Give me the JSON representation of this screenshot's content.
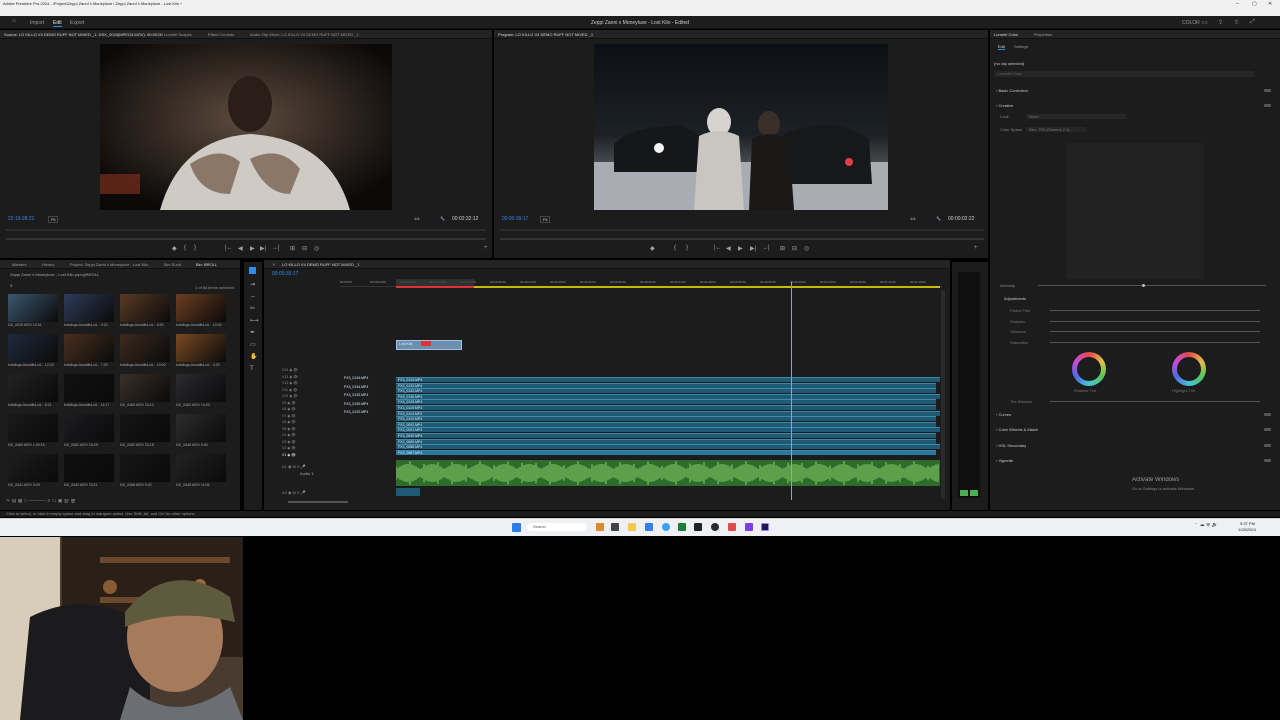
{
  "window": {
    "title": "Adobe Premiere Pro 2024 - \\Project\\Zeppi Zanni x Moneyluxe \\ Zeppi Zanni x Moneyluxe - Lost Kilo *",
    "controls": [
      "–",
      "▢",
      "✕"
    ]
  },
  "menu": [
    "File",
    "Edit",
    "Clip",
    "Sequence",
    "Markers",
    "Graphics and Titles",
    "View",
    "Window",
    "Help"
  ],
  "workspace": {
    "tabs": [
      "Import",
      "Edit",
      "Export"
    ],
    "active_tab": "Edit",
    "project_title": "Zeppi Zanni x Moneyluxe - Lost Kilo - Edited",
    "right_label": "COLOR"
  },
  "source_monitor": {
    "tabs": [
      "Source: LO KILLO V4 DEMO  RUFF NOT MIXED _1: DSX_0033(MPEG4.MOV): 00:00:00",
      "Lumetri Scopes",
      "Effect Controls",
      "Audio Clip Mixer: LO KILLO V4 DEMO  RUFF NOT MIXED _1"
    ],
    "timecode_left": "22:19:28:21",
    "fit": "Fit",
    "resolution": "1/4",
    "timecode_right": "00:02:32:12"
  },
  "program_monitor": {
    "tabs": [
      "Program: LO KILLO V4 DEMO  RUFF NOT MIXED _1"
    ],
    "timecode_left": "00:00:39:17",
    "fit": "Fit",
    "resolution": "1/4",
    "timecode_right": "00:00:02:22"
  },
  "transport_icons": [
    "◆",
    "{",
    "}",
    "|←",
    "◀",
    "▶",
    "▶|",
    "→|",
    "⊞",
    "⊟",
    "◎",
    "+"
  ],
  "project_panel": {
    "tabs": [
      "Markers",
      "History",
      "Project: Zeppi Zanni x Moneyluxe - Lost Kilo",
      "Bin: B-roll",
      "Bin: BROLL"
    ],
    "path": "Zeppi Zanni x Moneyluxe - Lost Kilo.prproj\\BROLL",
    "count": "1 of 84 items selected",
    "items": [
      {
        "name": "DJI_0026.MOV",
        "dur": "12:01"
      },
      {
        "name": "buildings-beautiful-cit...",
        "dur": "9:22"
      },
      {
        "name": "buildings-beautiful-cit...",
        "dur": "8:00"
      },
      {
        "name": "buildings-beautiful-cit...",
        "dur": "10:24"
      },
      {
        "name": "buildings-beautiful-cit...",
        "dur": "12:23"
      },
      {
        "name": "buildings-beautiful-cit...",
        "dur": "7:29"
      },
      {
        "name": "buildings-beautiful-cit...",
        "dur": "10:00"
      },
      {
        "name": "buildings-beautiful-cit...",
        "dur": "9:29"
      },
      {
        "name": "buildings-beautiful-cit...",
        "dur": "8:21"
      },
      {
        "name": "buildings-beautiful-cit...",
        "dur": "11:17"
      },
      {
        "name": "DJI_0463.MOV",
        "dur": "24:10"
      },
      {
        "name": "DJI_0462.MOV",
        "dur": "14:20"
      },
      {
        "name": "DJI_0460.MOV",
        "dur": "1:00:15"
      },
      {
        "name": "DJI_0451.MOV",
        "dur": "15:29"
      },
      {
        "name": "DJI_0452.MOV",
        "dur": "23:18"
      },
      {
        "name": "DJI_0446.MOV",
        "dur": "5:00"
      },
      {
        "name": "DJI_0441.MOV",
        "dur": "3:29"
      },
      {
        "name": "DJI_0442.MOV",
        "dur": "20:11"
      },
      {
        "name": "DJI_0456.MOV",
        "dur": "9:22"
      },
      {
        "name": "DJI_0448.MOV",
        "dur": "11:05"
      }
    ]
  },
  "timeline": {
    "tab": "LO KILLO V4 DEMO  RUFF NOT MIXED _1",
    "timecode": "00:00:39:17",
    "ruler": [
      "00:00:00",
      "00:00:04:00",
      "00:00:08:00",
      "00:00:12:00",
      "00:00:16:00",
      "00:00:20:00",
      "00:00:24:00",
      "00:00:28:00",
      "00:00:32:00",
      "00:00:36:00",
      "00:00:40:00",
      "00:00:44:00",
      "00:00:48:00",
      "00:00:52:00",
      "00:00:56:00",
      "00:01:00:00",
      "00:01:04:00",
      "00:01:08:00",
      "00:01:12:00",
      "00:01:16:00"
    ],
    "video_tracks": [
      "V14",
      "V13",
      "V12",
      "V11",
      "V10",
      "V9",
      "V8",
      "V7",
      "V6",
      "V5",
      "V4",
      "V3",
      "V2",
      "V1"
    ],
    "audio_tracks": [
      "A1",
      "A2"
    ],
    "audio_label": "Audio 1",
    "clips": [
      "FX3_0134.MP4",
      "FX3_0133.MP4",
      "FX3_0132.MP4",
      "FX3_0130.MP4",
      "FX3_0129.MP4",
      "FX3_0119.MP4",
      "FX3_0113.MP4",
      "FX3_0110.MP4",
      "FX3_0092.MP4",
      "FX3_0091.MP4",
      "FX3_0090.MP4",
      "FX3_0089.MP4",
      "FX3_0088.MP4",
      "FX3_0087.MP4"
    ],
    "left_clips": [
      "FX3_0134.MP4",
      "FX3_0134.MP4",
      "FX3_0133.MP4",
      "FX3_0130.MP4",
      "FX3_0132.MP4"
    ],
    "graphic_label": "Lost Kilo"
  },
  "lumetri": {
    "tabs": [
      "Lumetri Color",
      "Properties"
    ],
    "subtabs": [
      "Edit",
      "Settings"
    ],
    "no_clip": "(no clip selected)",
    "lookup": "Lumetri Color",
    "sections": [
      "Basic Correction",
      "Creative",
      "Curves",
      "Color Wheels & Match",
      "HSL Secondary",
      "Vignette"
    ],
    "creative": {
      "look_label": "Look",
      "look_value": "None",
      "color_space_label": "Color Space",
      "color_space_value": "Rec. 709 (Gamma 2.4)"
    },
    "intensity_label": "Intensity",
    "adjustments_label": "Adjustments",
    "adjustments": [
      "Faded Film",
      "Sharpen",
      "Vibrance",
      "Saturation"
    ],
    "wheels": [
      "Shadow Tint",
      "Highlight Tint"
    ],
    "tint_balance": "Tint Balance",
    "activate": {
      "title": "Activate Windows",
      "sub": "Go to Settings to activate Windows."
    }
  },
  "status_bar": "Click to select, or click in empty space and drag to marquee select. Use Shift, Alt, and Ctrl for other options.",
  "taskbar": {
    "search_placeholder": "Search",
    "clock": "9:37 PM",
    "date": "1/28/2024"
  },
  "colors": {
    "accent": "#2d8ceb",
    "video_clip": "#1f5a74",
    "audio_clip": "#4f9d3a",
    "playhead": "#2d8ceb"
  }
}
